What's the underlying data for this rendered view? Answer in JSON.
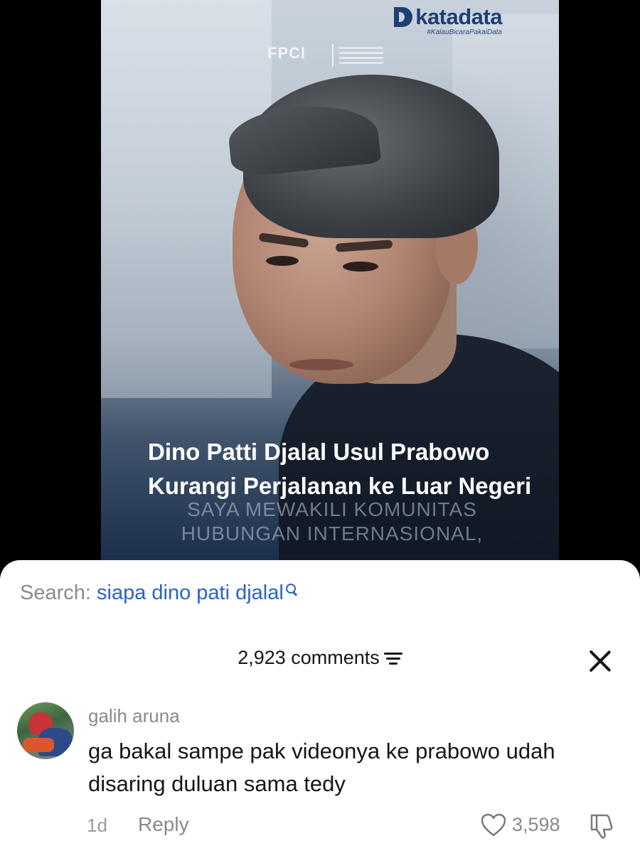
{
  "video": {
    "brand_name": "katadata",
    "brand_tagline": "#KalauBicaraPakaiData",
    "partner_logo": "FPCI",
    "headline": "Dino Patti Djalal Usul Prabowo Kurangi Perjalanan ke Luar Negeri",
    "ghost_caption": "SAYA MEWAKILI KOMUNITAS HUBUNGAN INTERNASIONAL,"
  },
  "search": {
    "prefix": "Search:",
    "query": "siapa dino pati djalal",
    "icon": "search-icon"
  },
  "comments_header": {
    "count_label": "2,923 comments",
    "sort_icon": "sort-icon",
    "close_icon": "close-icon"
  },
  "comment": {
    "username": "galih aruna",
    "text": "ga bakal sampe pak videonya ke prabowo udah disaring duluan sama tedy",
    "time": "1d",
    "reply_label": "Reply",
    "like_count": "3,598",
    "like_icon": "heart-icon",
    "dislike_icon": "thumbs-down-icon"
  }
}
